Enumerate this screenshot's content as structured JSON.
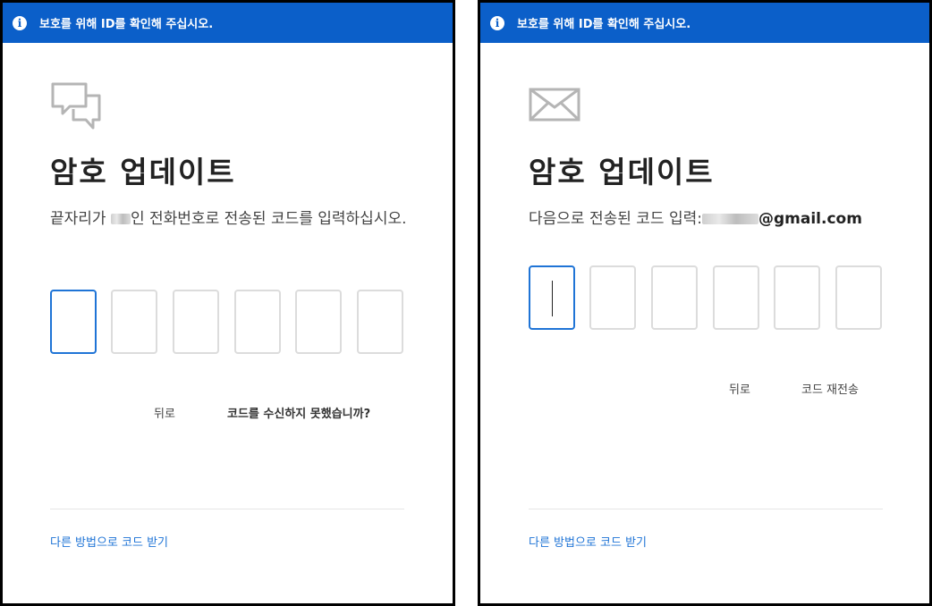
{
  "banner": {
    "icon": "info-icon",
    "text": "보호를 위해 ID를 확인해 주십시오."
  },
  "left_panel": {
    "icon": "chat-bubbles-icon",
    "title": "암호 업데이트",
    "desc_prefix": "끝자리가",
    "desc_suffix": "인 전화번호로 전송된 코드를 입력하십시오.",
    "code_boxes": [
      "",
      "",
      "",
      "",
      "",
      ""
    ],
    "back_label": "뒤로",
    "no_code_label": "코드를 수신하지 못했습니까?",
    "alt_method_label": "다른 방법으로 코드 받기"
  },
  "right_panel": {
    "icon": "envelope-icon",
    "title": "암호 업데이트",
    "desc_prefix": "다음으로 전송된 코드 입력:",
    "email_suffix": "@gmail.com",
    "code_boxes": [
      "",
      "",
      "",
      "",
      "",
      ""
    ],
    "back_label": "뒤로",
    "resend_label": "코드 재전송",
    "alt_method_label": "다른 방법으로 코드 받기"
  },
  "colors": {
    "banner": "#0b5fc9",
    "active_border": "#1f74d6",
    "link": "#1f74d6",
    "box_border": "#dcdcdc"
  }
}
